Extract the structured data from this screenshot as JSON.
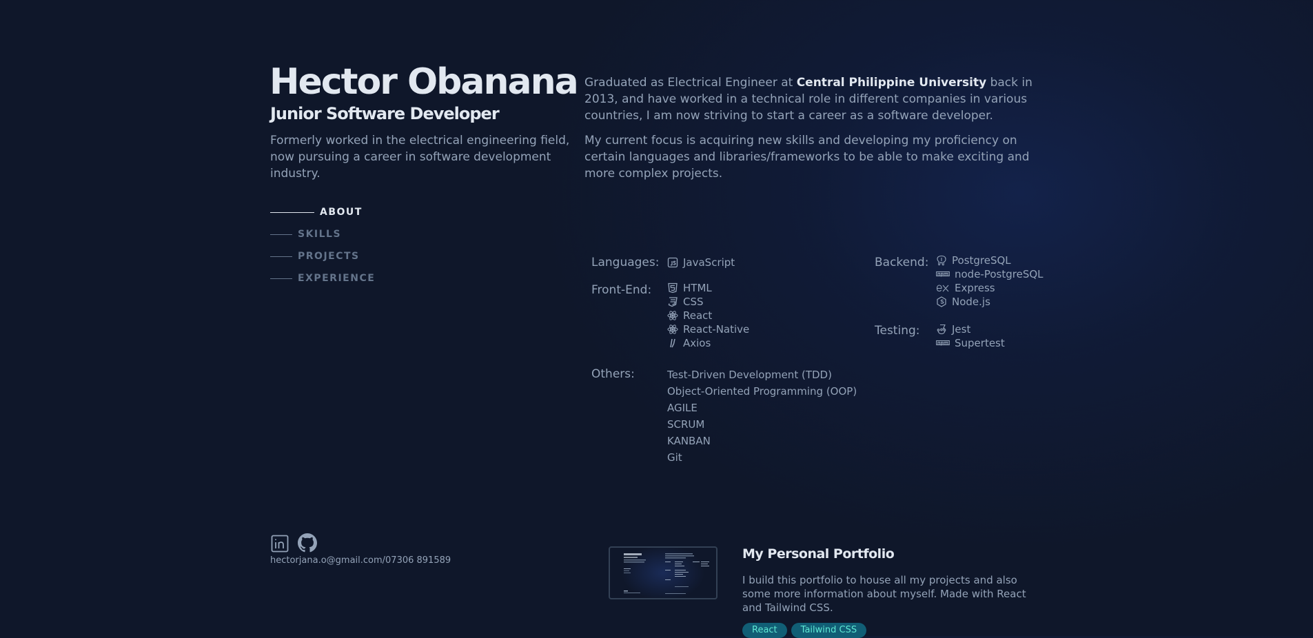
{
  "header": {
    "name": "Hector Obanana",
    "role": "Junior Software Developer",
    "tagline": "Formerly worked in the electrical engineering field, now pursuing a career in software development industry."
  },
  "nav": {
    "items": [
      {
        "label": "ABOUT",
        "active": true
      },
      {
        "label": "SKILLS",
        "active": false
      },
      {
        "label": "PROJECTS",
        "active": false
      },
      {
        "label": "EXPERIENCE",
        "active": false
      }
    ]
  },
  "about": {
    "p1_before": "Graduated as Electrical Engineer at ",
    "p1_bold": "Central Philippine University",
    "p1_after": " back in 2013, and have worked in a technical role in different companies in various countries, I am now striving to start a career as a software developer.",
    "p2": "My current focus is acquiring new skills and developing my proficiency on certain languages and libraries/frameworks to be able to make exciting and more complex projects."
  },
  "skills": {
    "languages_label": "Languages:",
    "languages": [
      {
        "name": "JavaScript",
        "icon": "javascript-icon"
      }
    ],
    "frontend_label": "Front-End:",
    "frontend": [
      {
        "name": "HTML",
        "icon": "html5-icon"
      },
      {
        "name": "CSS",
        "icon": "css3-icon"
      },
      {
        "name": "React",
        "icon": "react-icon"
      },
      {
        "name": "React-Native",
        "icon": "react-icon"
      },
      {
        "name": "Axios",
        "icon": "axios-icon"
      }
    ],
    "others_label": "Others:",
    "others": [
      "Test-Driven Development (TDD)",
      "Object-Oriented Programming (OOP)",
      "AGILE",
      "SCRUM",
      "KANBAN",
      "Git"
    ],
    "backend_label": "Backend:",
    "backend": [
      {
        "name": "PostgreSQL",
        "icon": "postgresql-icon"
      },
      {
        "name": "node-PostgreSQL",
        "icon": "npm-icon"
      },
      {
        "name": "Express",
        "icon": "express-icon"
      },
      {
        "name": "Node.js",
        "icon": "nodejs-icon"
      }
    ],
    "testing_label": "Testing:",
    "testing": [
      {
        "name": "Jest",
        "icon": "jest-icon"
      },
      {
        "name": "Supertest",
        "icon": "npm-icon"
      }
    ]
  },
  "contact": {
    "text": "hectorjana.o@gmail.com/07306 891589",
    "social": [
      {
        "icon": "linkedin-icon"
      },
      {
        "icon": "github-icon"
      }
    ]
  },
  "project": {
    "title": "My Personal Portfolio",
    "description": "I build this portfolio to house all my projects and also some more information about myself. Made with React and Tailwind CSS.",
    "tags": [
      "React",
      "Tailwind CSS"
    ]
  },
  "colors": {
    "background": "#0f172a",
    "heading": "#e2e8f0",
    "text": "#94a3b8",
    "muted": "#64748b",
    "tag_bg": "#115e75",
    "tag_text": "#5eead4"
  }
}
